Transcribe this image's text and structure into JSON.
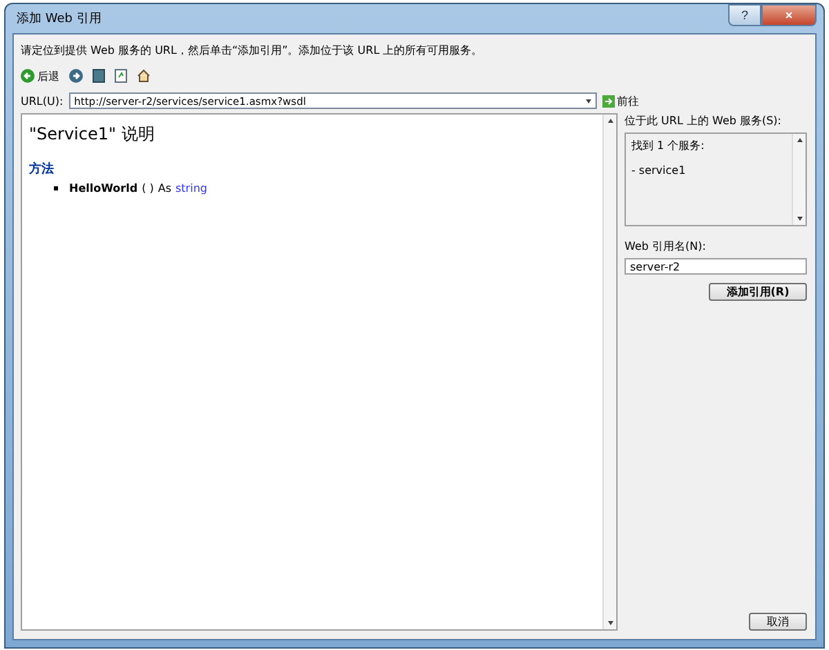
{
  "window": {
    "title": "添加 Web 引用",
    "help_button": "?",
    "close_button": "×"
  },
  "instruction": "请定位到提供 Web 服务的 URL，然后单击“添加引用”。添加位于该 URL 上的所有可用服务。",
  "toolbar": {
    "back_label": "后退"
  },
  "url": {
    "label": "URL(U):",
    "value": "http://server-r2/services/service1.asmx?wsdl",
    "go_label": "前往"
  },
  "browser": {
    "heading_name": "\"Service1\"",
    "heading_suffix": "说明",
    "section": "方法",
    "methods": [
      {
        "name": "HelloWorld",
        "params": "( )",
        "as": "As",
        "type": "string"
      }
    ]
  },
  "services": {
    "label": "位于此 URL 上的 Web 服务(S):",
    "lines": [
      "找到 1 个服务:",
      "- service1"
    ]
  },
  "reference": {
    "label": "Web 引用名(N):",
    "value": "server-r2",
    "add_button": "添加引用(R)"
  },
  "cancel_button": "取消"
}
